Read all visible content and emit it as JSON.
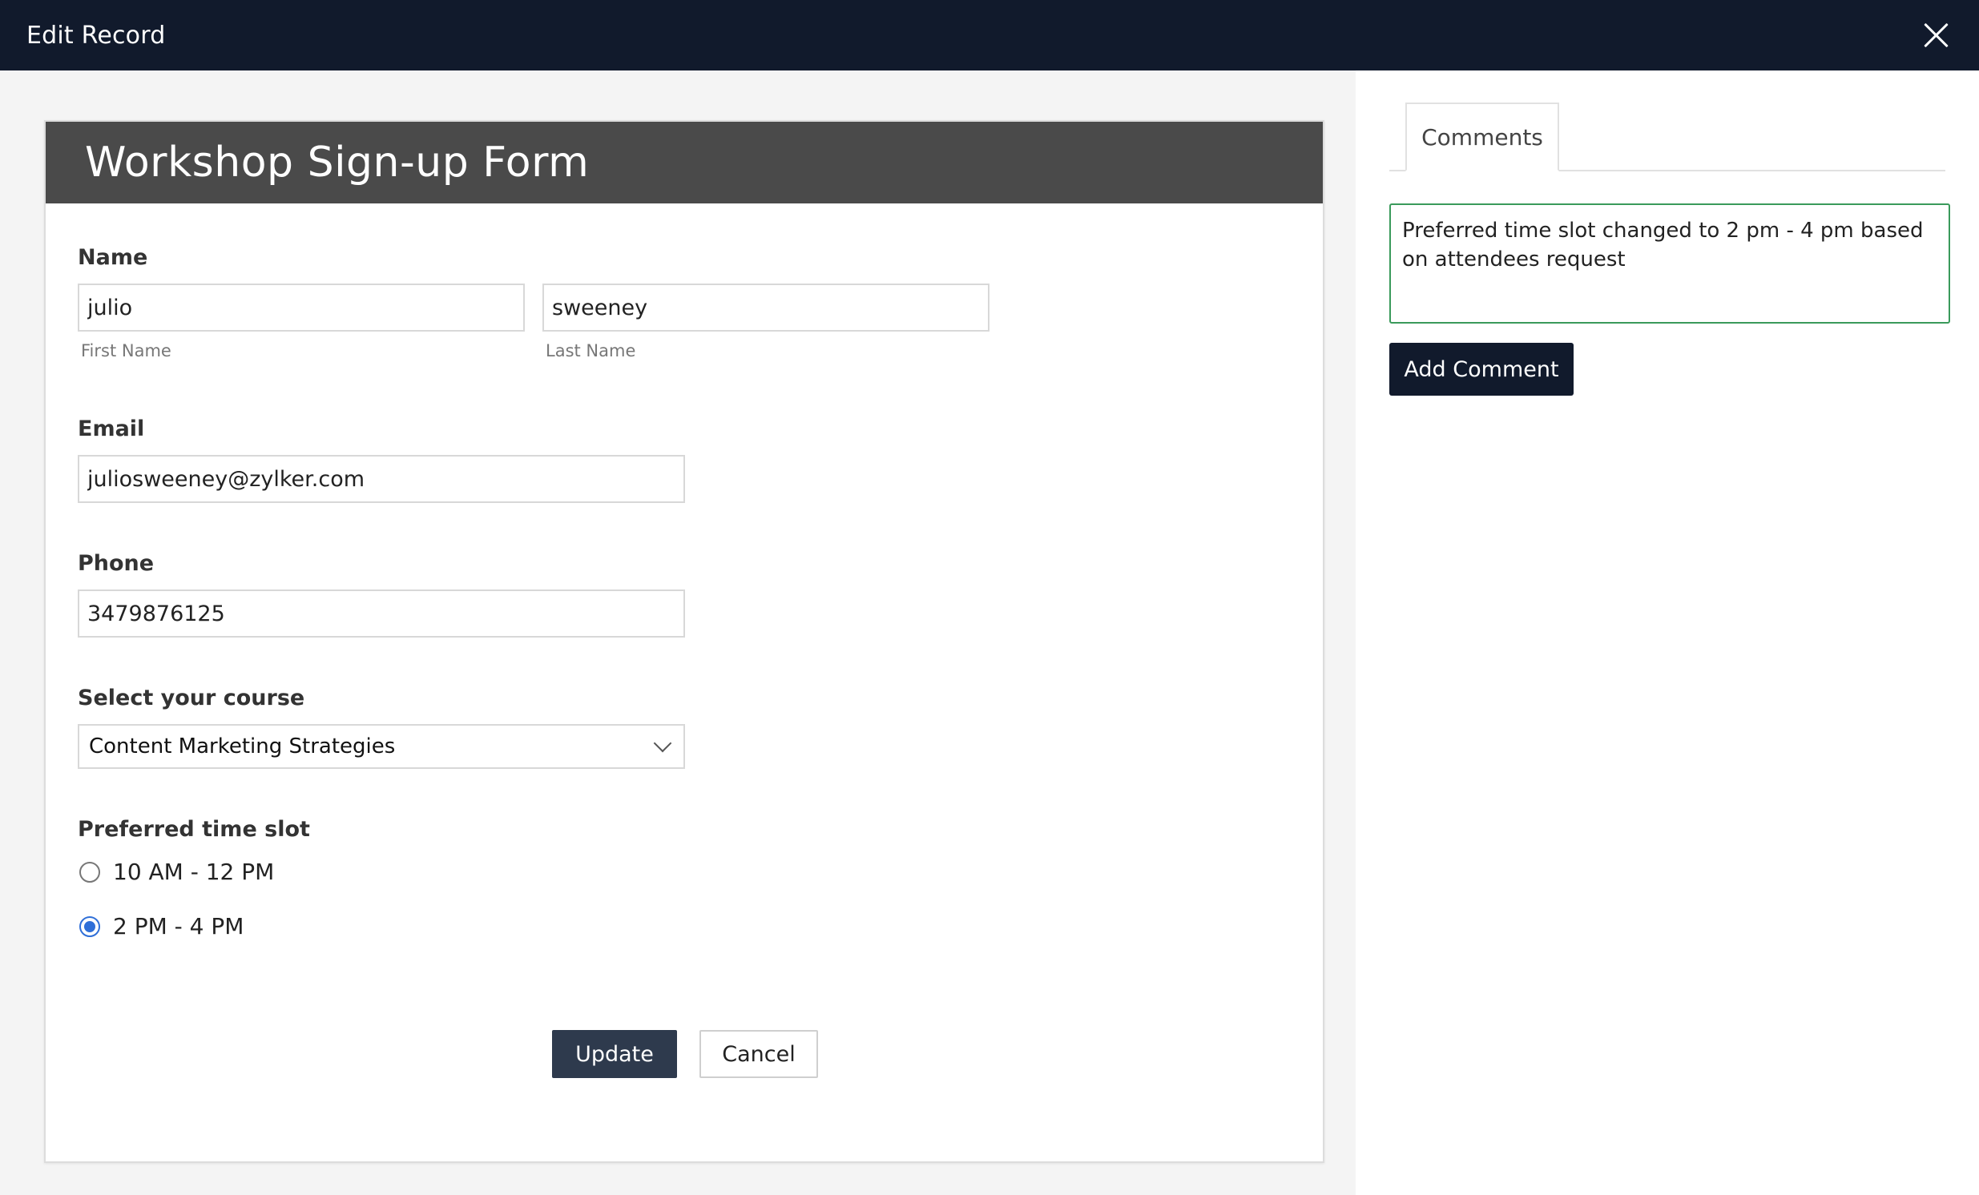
{
  "window": {
    "title": "Edit Record"
  },
  "form": {
    "title": "Workshop Sign-up Form",
    "name": {
      "label": "Name",
      "first_value": "julio",
      "first_sublabel": "First Name",
      "last_value": "sweeney",
      "last_sublabel": "Last Name"
    },
    "email": {
      "label": "Email",
      "value": "juliosweeney@zylker.com"
    },
    "phone": {
      "label": "Phone",
      "value": "3479876125"
    },
    "course": {
      "label": "Select your course",
      "selected": "Content Marketing Strategies"
    },
    "time_slot": {
      "label": "Preferred time slot",
      "options": [
        {
          "label": "10 AM - 12 PM",
          "checked": false
        },
        {
          "label": "2 PM - 4 PM",
          "checked": true
        }
      ]
    },
    "buttons": {
      "update": "Update",
      "cancel": "Cancel"
    }
  },
  "comments_panel": {
    "tab_label": "Comments",
    "comment_text": "Preferred time slot changed to 2 pm - 4 pm based on attendees request",
    "add_button": "Add Comment"
  }
}
